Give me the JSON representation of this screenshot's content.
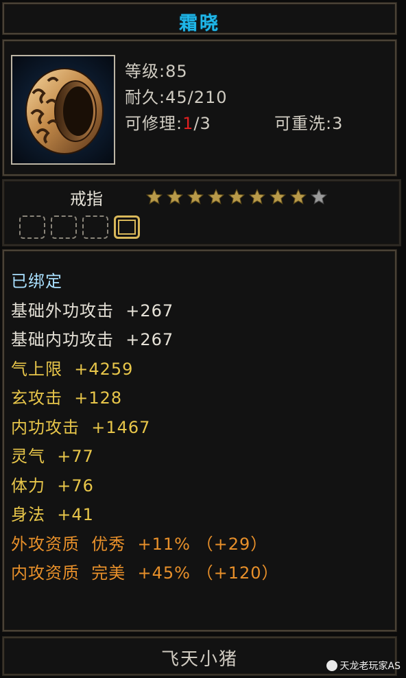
{
  "title": "霜晓",
  "item": {
    "level_label": "等级",
    "level_value": "85",
    "durability_label": "耐久",
    "durability_value": "45/210",
    "repair_label": "可修理",
    "repair_current": "1",
    "repair_max": "/3",
    "rewash_label": "可重洗",
    "rewash_value": "3",
    "type": "戒指",
    "stars_filled": 8,
    "stars_total": 9,
    "gem_slots": [
      {
        "state": "empty"
      },
      {
        "state": "empty"
      },
      {
        "state": "empty"
      },
      {
        "state": "active"
      }
    ],
    "icon": "ring-icon"
  },
  "attributes": [
    {
      "name": "已绑定",
      "value": "",
      "color": "#a9e0ff"
    },
    {
      "name": "基础外功攻击",
      "value": "+267",
      "color": "#e6e2d8"
    },
    {
      "name": "基础内功攻击",
      "value": "+267",
      "color": "#e6e2d8"
    },
    {
      "name": "气上限",
      "value": "+4259",
      "color": "#e8c64a"
    },
    {
      "name": "玄攻击",
      "value": "+128",
      "color": "#e8c64a"
    },
    {
      "name": "内功攻击",
      "value": "+1467",
      "color": "#e8c64a"
    },
    {
      "name": "灵气",
      "value": "+77",
      "color": "#e8c64a"
    },
    {
      "name": "体力",
      "value": "+76",
      "color": "#e8c64a"
    },
    {
      "name": "身法",
      "value": "+41",
      "color": "#e8c64a"
    },
    {
      "name": "外攻资质",
      "value": "优秀  +11% （+29）",
      "color": "#e8902a"
    },
    {
      "name": "内攻资质",
      "value": "完美  +45% （+120）",
      "color": "#e8902a"
    }
  ],
  "owner": "飞天小猪",
  "watermark": "天龙老玩家AS"
}
